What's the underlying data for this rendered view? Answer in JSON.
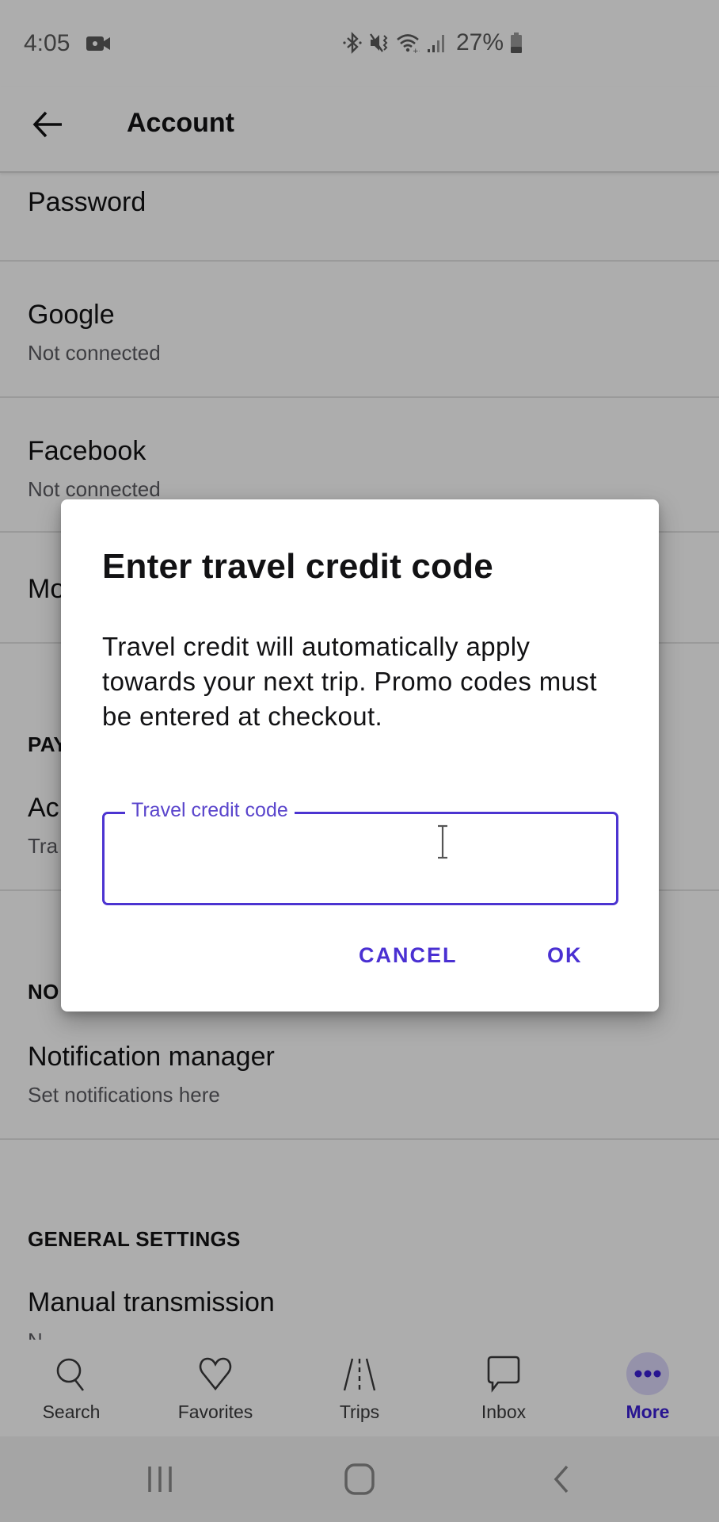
{
  "status_bar": {
    "time": "4:05",
    "left_icons": [
      "video-camera-icon"
    ],
    "right_icons": [
      "bluetooth-icon",
      "mute-vibrate-icon",
      "wifi-icon",
      "cellular-signal-icon",
      "battery-icon"
    ],
    "battery_percent": "27%"
  },
  "app_bar": {
    "back_icon": "arrow-left-icon",
    "title": "Account"
  },
  "list": {
    "items": [
      {
        "title": "Password",
        "subtitle": ""
      },
      {
        "title": "Google",
        "subtitle": "Not connected"
      },
      {
        "title": "Facebook",
        "subtitle": "Not connected"
      },
      {
        "title": "Mo",
        "subtitle": ""
      }
    ],
    "payment_header": "PAY",
    "payment_item": {
      "title": "Ac",
      "subtitle": "Tra"
    },
    "notifications_header": "NO",
    "notification_item": {
      "title": "Notification manager",
      "subtitle": "Set notifications here"
    },
    "general_header": "GENERAL SETTINGS",
    "general_item": {
      "title": "Manual transmission",
      "subtitle": "N"
    }
  },
  "dialog": {
    "title": "Enter travel credit code",
    "body": "Travel credit will automatically apply towards your next trip. Promo codes must be entered at checkout.",
    "field_label": "Travel credit code",
    "field_value": "",
    "cancel_label": "CANCEL",
    "ok_label": "OK"
  },
  "bottom_nav": {
    "items": [
      {
        "label": "Search",
        "icon": "search-icon",
        "active": false
      },
      {
        "label": "Favorites",
        "icon": "heart-icon",
        "active": false
      },
      {
        "label": "Trips",
        "icon": "road-icon",
        "active": false
      },
      {
        "label": "Inbox",
        "icon": "chat-bubble-icon",
        "active": false
      },
      {
        "label": "More",
        "icon": "more-dots-icon",
        "active": true
      }
    ]
  },
  "system_nav": {
    "buttons": [
      "recent-apps-icon",
      "home-icon",
      "back-icon"
    ]
  },
  "colors": {
    "accent": "#593CFB",
    "scrim": "rgba(0,0,0,0.32)",
    "text_primary": "#121214",
    "text_secondary": "#5C5C62"
  }
}
